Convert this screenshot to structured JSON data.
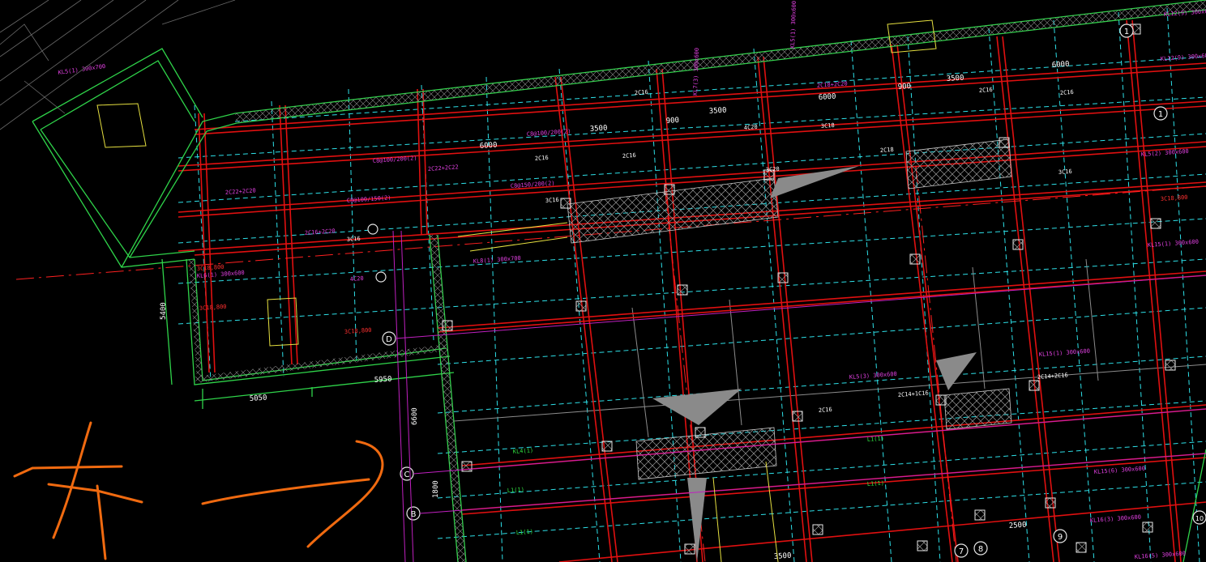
{
  "drawing": {
    "dimensions": {
      "d_5400": "5400",
      "d_5050": "5050",
      "d_5950": "5950",
      "d_6000_a": "6000",
      "d_6000_b": "6000",
      "d_6000_c": "6000",
      "d_3500_a": "3500",
      "d_3500_b": "3500",
      "d_3500_c": "3500",
      "d_3500_d": "3500",
      "d_2500": "2500",
      "d_900_a": "900",
      "d_900_b": "900",
      "d_6600": "6600",
      "d_1800": "1800"
    },
    "axes": {
      "ax_d": "D",
      "ax_c": "C",
      "ax_b": "B",
      "ax_9": "9",
      "ax_8": "8",
      "ax_7": "7",
      "ax_10": "10",
      "ax_1_1": "1",
      "ax_1_2": "1"
    },
    "labels": {
      "kl_a": "KL5(1) 300x700",
      "kl_b": "KL8(1) 300x700",
      "kl_c": "KL5(3) 300x600",
      "kl_d": "KL15(6) 300x600",
      "kl_e": "KL12(9) 300x600",
      "kl_f": "KL6(1) 300x600",
      "kl_g": "KL15(1) 300x600",
      "kl_h": "KL5(2) 300x600",
      "kl_i": "KL15(1) 300x600",
      "kl_j": "KL16(3) 300x600",
      "kl_k": "KL7(3) 300x600",
      "kl_l": "KL5(1) 300x600",
      "kl_m": "KL12(9) 300x600",
      "kl_n": "KL16(5) 300x600",
      "red_a": "3C18,800",
      "red_b": "3C18,800",
      "red_c": "3C18,800",
      "red_d": "3C18,800",
      "pink_a": "2C22+2C20",
      "pink_b": "4C20",
      "pink_c": "2C18+2C20",
      "pink_d": "2C16+2C20",
      "pink_e": "2C22+2C22",
      "pink_f": "C8@100/200(2)",
      "pink_g": "C8@100/200(2)",
      "pink_h": "C8@100/150(2)",
      "pink_i": "C8@150/200(2)",
      "white_a": "3C16",
      "white_b": "3C20",
      "white_c": "2C16",
      "white_d": "2C16",
      "white_e": "2C16",
      "white_f": "3C16",
      "white_g": "2C16",
      "white_h": "4C20",
      "white_i": "2C18",
      "white_j": "2C16",
      "white_k": "3C18",
      "white_l": "3C16",
      "white_m": "2C14+1C16",
      "white_n": "2C14+2C16",
      "white_o": "2C16",
      "green_a": "KL4(1)",
      "green_b": "L1(1)",
      "green_c": "L1(1)",
      "green_d": "L1(1)",
      "green_e": "L1(1)"
    }
  }
}
